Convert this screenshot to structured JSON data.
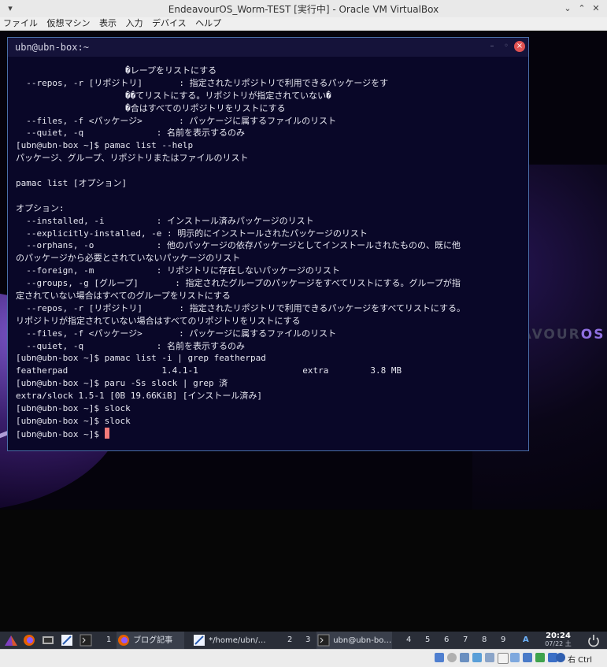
{
  "window": {
    "title": "EndeavourOS_Worm-TEST [実行中] - Oracle VM VirtualBox",
    "btn_min": "⌄",
    "btn_max": "⌃",
    "btn_close": "✕",
    "pin": "▾"
  },
  "menubar": [
    "ファイル",
    "仮想マシン",
    "表示",
    "入力",
    "デバイス",
    "ヘルプ"
  ],
  "terminal": {
    "title": "ubn@ubn-box:~",
    "lines": [
      "                     �レープをリストにする",
      "  --repos, -r [リポジトリ]       : 指定されたリポジトリで利用できるパッケージをす",
      "                     ��てリストにする。リポジトリが指定されていない�",
      "                     �合はすべてのリポジトリをリストにする",
      "  --files, -f <パッケージ>       : パッケージに属するファイルのリスト",
      "  --quiet, -q              : 名前を表示するのみ",
      "[ubn@ubn-box ~]$ pamac list --help",
      "パッケージ、グループ、リポジトリまたはファイルのリスト",
      "",
      "pamac list [オプション]",
      "",
      "オプション:",
      "  --installed, -i          : インストール済みパッケージのリスト",
      "  --explicitly-installed, -e : 明示的にインストールされたパッケージのリスト",
      "  --orphans, -o            : 他のパッケージの依存パッケージとしてインストールされたものの、既に他",
      "のパッケージから必要とされていないパッケージのリスト",
      "  --foreign, -m            : リポジトリに存在しないパッケージのリスト",
      "  --groups, -g [グループ]       : 指定されたグループのパッケージをすべてリストにする。グループが指",
      "定されていない場合はすべてのグループをリストにする",
      "  --repos, -r [リポジトリ]       : 指定されたリポジトリで利用できるパッケージをすべてリストにする。",
      "リポジトリが指定されていない場合はすべてのリポジトリをリストにする",
      "  --files, -f <パッケージ>       : パッケージに属するファイルのリスト",
      "  --quiet, -q              : 名前を表示するのみ",
      "[ubn@ubn-box ~]$ pamac list -i | grep featherpad",
      "featherpad                  1.4.1-1                    extra        3.8 MB",
      "[ubn@ubn-box ~]$ paru -Ss slock | grep 済",
      "extra/slock 1.5-1 [0B 19.66KiB] [インストール済み]",
      "[ubn@ubn-box ~]$ slock",
      "[ubn@ubn-box ~]$ slock"
    ],
    "prompt": "[ubn@ubn-box ~]$ ",
    "btn_min": "–",
    "btn_max": "◦",
    "btn_close": "×"
  },
  "wallpaper": {
    "logo_prefix": "ENDEAVOUR",
    "logo_suffix": "OS"
  },
  "taskbar": {
    "ws1": "1",
    "ws2": "2",
    "ws3": "3",
    "ws4": "4",
    "ws5": "5",
    "ws6": "6",
    "ws7": "7",
    "ws8": "8",
    "ws9": "9",
    "firefox_task": "ブログ記事編…",
    "featherpad_task": "*/home/ubn/…",
    "terminal_task": "ubn@ubn-bo…",
    "ime": "A",
    "time": "20:24",
    "date": "07/22 土"
  },
  "statusbar": {
    "host_key": "右 Ctrl"
  },
  "colors": {
    "accent": "#4a6ea8",
    "cursor": "#f27a7a",
    "terminal_bg": "#090728"
  }
}
